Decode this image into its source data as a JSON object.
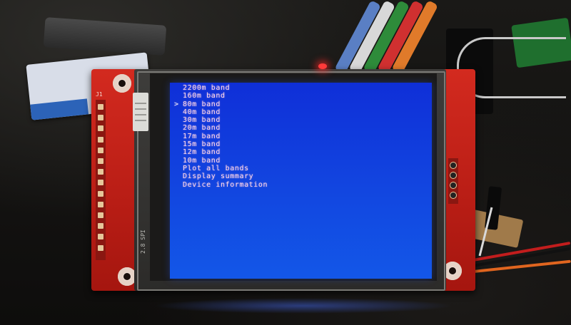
{
  "device": {
    "header_label": "J1",
    "edge_label": "2.8 SPI"
  },
  "menu": {
    "selected_index": 2,
    "cursor": ">",
    "items": [
      "2200m band",
      "160m band",
      "80m band",
      "40m band",
      "30m band",
      "20m band",
      "17m band",
      "15m band",
      "12m band",
      "10m band",
      "Plot all bands",
      "Display summary",
      "Device information"
    ]
  },
  "colors": {
    "screen_background": "#1246e0",
    "menu_text": "#ffd9e8",
    "pcb": "#c8231a",
    "status_led": "#ff3a3a"
  }
}
